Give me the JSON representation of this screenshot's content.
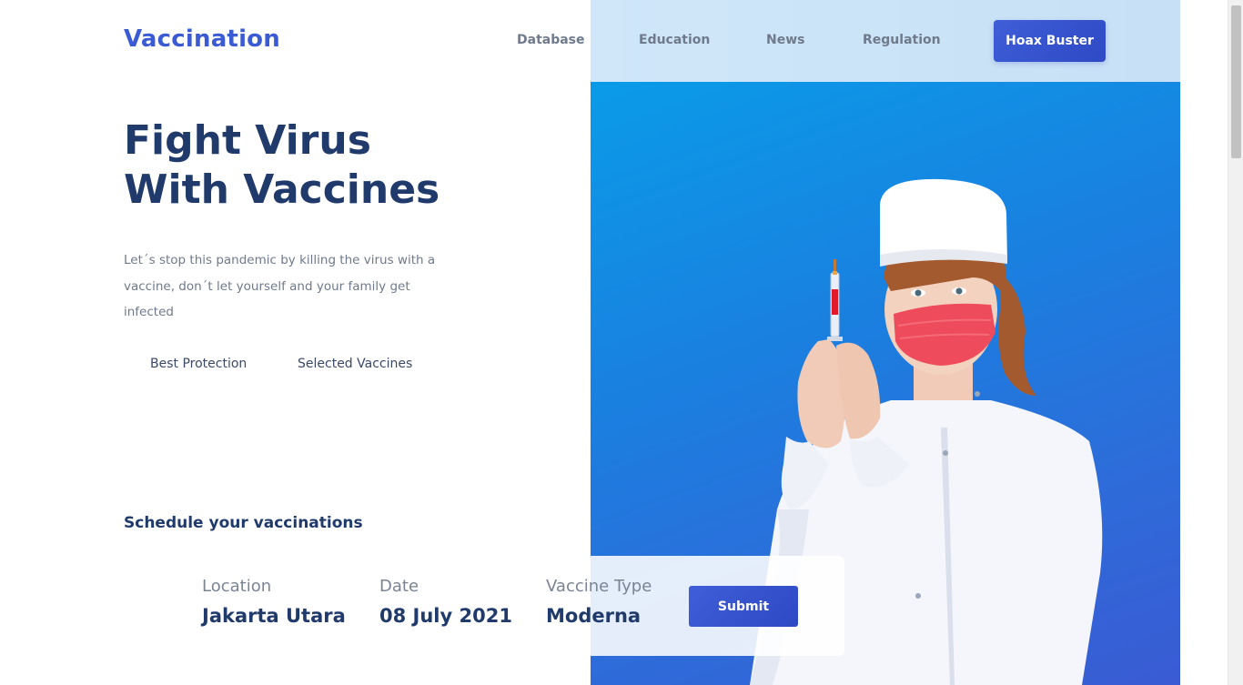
{
  "header": {
    "brand": "Vaccination",
    "nav": [
      {
        "label": "Database"
      },
      {
        "label": "Education"
      },
      {
        "label": "News"
      },
      {
        "label": "Regulation"
      }
    ],
    "cta_label": "Hoax Buster"
  },
  "hero": {
    "title_line1": "Fight Virus",
    "title_line2": "With Vaccines",
    "description": "Let´s stop this pandemic by killing the virus with a vaccine, don´t let yourself and your family get infected",
    "features": [
      {
        "label": "Best Protection"
      },
      {
        "label": "Selected Vaccines"
      }
    ]
  },
  "schedule": {
    "title": "Schedule your vaccinations",
    "fields": [
      {
        "label": "Location",
        "value": "Jakarta Utara"
      },
      {
        "label": "Date",
        "value": "08 July 2021"
      },
      {
        "label": "Vaccine Type",
        "value": "Moderna"
      }
    ],
    "submit_label": "Submit"
  },
  "colors": {
    "brand": "#3a5bd3",
    "heading": "#1f3a6b",
    "hero_gradient_start": "#0a9be8",
    "hero_gradient_end": "#3a5bd3"
  },
  "icons": {
    "hero_image": "nurse-with-syringe-image"
  }
}
